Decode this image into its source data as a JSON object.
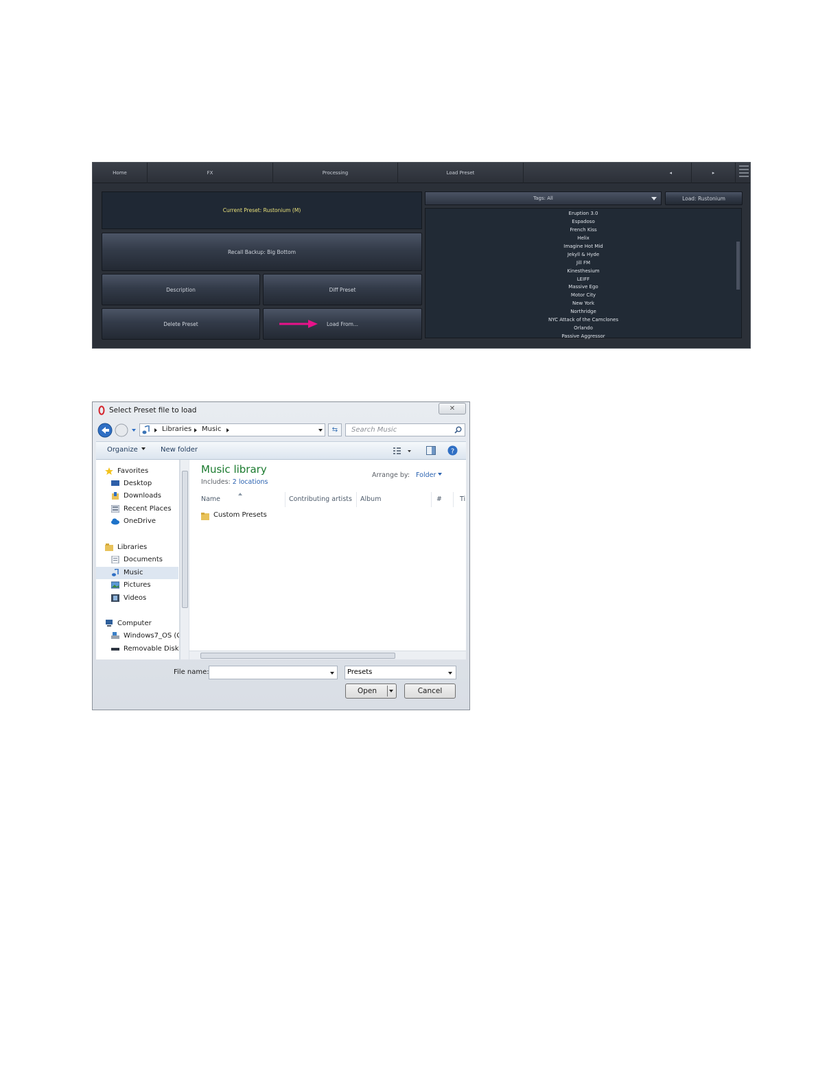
{
  "top_panel": {
    "nav": [
      "Home",
      "FX",
      "Processing",
      "Load Preset"
    ],
    "nav_prev": "◂",
    "nav_next": "▸",
    "current_preset": "Current Preset: Rustonium (M)",
    "recall_backup": "Recall Backup: Big Bottom",
    "description": "Description",
    "diff_preset": "Diff Preset",
    "delete_preset": "Delete Preset",
    "load_from": "Load From...",
    "tags": "Tags: All",
    "load_button": "Load: Rustonium",
    "presets": [
      "Eruption 3.0",
      "Espadoso",
      "French Kiss",
      "Helix",
      "Imagine Hot Mid",
      "Jekyll & Hyde",
      "Jill FM",
      "Kinesthesium",
      "LEIFF",
      "Massive Ego",
      "Motor City",
      "New York",
      "Northridge",
      "NYC Attack of the Camclones",
      "Orlando",
      "Passive Aggressor"
    ],
    "arrow_color": "#e8128a"
  },
  "dialog": {
    "title": "Select Preset file to load",
    "close": "✕",
    "breadcrumb": [
      "Libraries",
      "Music"
    ],
    "search_placeholder": "Search Music",
    "organize": "Organize",
    "new_folder": "New folder",
    "nav": {
      "favorites": "Favorites",
      "desktop": "Desktop",
      "downloads": "Downloads",
      "recent_places": "Recent Places",
      "onedrive": "OneDrive",
      "libraries": "Libraries",
      "documents": "Documents",
      "music": "Music",
      "pictures": "Pictures",
      "videos": "Videos",
      "computer": "Computer",
      "windows_os": "Windows7_OS (C",
      "removable_disk": "Removable Disk ("
    },
    "library_title": "Music library",
    "includes_label": "Includes:",
    "includes_value": "2 locations",
    "arrange_by": "Arrange by:",
    "arrange_value": "Folder",
    "columns": [
      "Name",
      "Contributing artists",
      "Album",
      "#",
      "Ti"
    ],
    "items": [
      "Custom Presets"
    ],
    "file_name_label": "File name:",
    "file_name_value": "",
    "filter": "Presets",
    "open": "Open",
    "cancel": "Cancel"
  }
}
